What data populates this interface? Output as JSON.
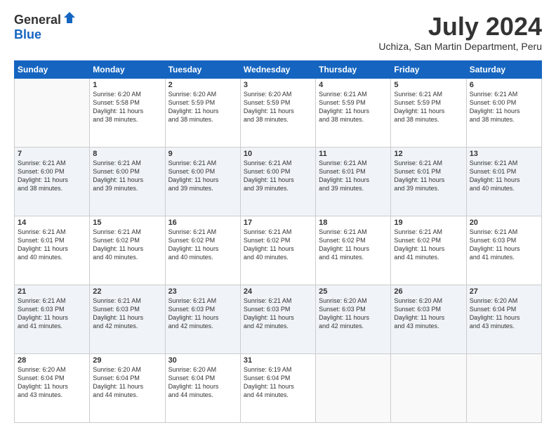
{
  "header": {
    "logo_general": "General",
    "logo_blue": "Blue",
    "month_title": "July 2024",
    "location": "Uchiza, San Martin Department, Peru"
  },
  "days_of_week": [
    "Sunday",
    "Monday",
    "Tuesday",
    "Wednesday",
    "Thursday",
    "Friday",
    "Saturday"
  ],
  "weeks": [
    [
      {
        "day": "",
        "info": ""
      },
      {
        "day": "1",
        "info": "Sunrise: 6:20 AM\nSunset: 5:58 PM\nDaylight: 11 hours\nand 38 minutes."
      },
      {
        "day": "2",
        "info": "Sunrise: 6:20 AM\nSunset: 5:59 PM\nDaylight: 11 hours\nand 38 minutes."
      },
      {
        "day": "3",
        "info": "Sunrise: 6:20 AM\nSunset: 5:59 PM\nDaylight: 11 hours\nand 38 minutes."
      },
      {
        "day": "4",
        "info": "Sunrise: 6:21 AM\nSunset: 5:59 PM\nDaylight: 11 hours\nand 38 minutes."
      },
      {
        "day": "5",
        "info": "Sunrise: 6:21 AM\nSunset: 5:59 PM\nDaylight: 11 hours\nand 38 minutes."
      },
      {
        "day": "6",
        "info": "Sunrise: 6:21 AM\nSunset: 6:00 PM\nDaylight: 11 hours\nand 38 minutes."
      }
    ],
    [
      {
        "day": "7",
        "info": "Sunrise: 6:21 AM\nSunset: 6:00 PM\nDaylight: 11 hours\nand 38 minutes."
      },
      {
        "day": "8",
        "info": "Sunrise: 6:21 AM\nSunset: 6:00 PM\nDaylight: 11 hours\nand 39 minutes."
      },
      {
        "day": "9",
        "info": "Sunrise: 6:21 AM\nSunset: 6:00 PM\nDaylight: 11 hours\nand 39 minutes."
      },
      {
        "day": "10",
        "info": "Sunrise: 6:21 AM\nSunset: 6:00 PM\nDaylight: 11 hours\nand 39 minutes."
      },
      {
        "day": "11",
        "info": "Sunrise: 6:21 AM\nSunset: 6:01 PM\nDaylight: 11 hours\nand 39 minutes."
      },
      {
        "day": "12",
        "info": "Sunrise: 6:21 AM\nSunset: 6:01 PM\nDaylight: 11 hours\nand 39 minutes."
      },
      {
        "day": "13",
        "info": "Sunrise: 6:21 AM\nSunset: 6:01 PM\nDaylight: 11 hours\nand 40 minutes."
      }
    ],
    [
      {
        "day": "14",
        "info": "Sunrise: 6:21 AM\nSunset: 6:01 PM\nDaylight: 11 hours\nand 40 minutes."
      },
      {
        "day": "15",
        "info": "Sunrise: 6:21 AM\nSunset: 6:02 PM\nDaylight: 11 hours\nand 40 minutes."
      },
      {
        "day": "16",
        "info": "Sunrise: 6:21 AM\nSunset: 6:02 PM\nDaylight: 11 hours\nand 40 minutes."
      },
      {
        "day": "17",
        "info": "Sunrise: 6:21 AM\nSunset: 6:02 PM\nDaylight: 11 hours\nand 40 minutes."
      },
      {
        "day": "18",
        "info": "Sunrise: 6:21 AM\nSunset: 6:02 PM\nDaylight: 11 hours\nand 41 minutes."
      },
      {
        "day": "19",
        "info": "Sunrise: 6:21 AM\nSunset: 6:02 PM\nDaylight: 11 hours\nand 41 minutes."
      },
      {
        "day": "20",
        "info": "Sunrise: 6:21 AM\nSunset: 6:03 PM\nDaylight: 11 hours\nand 41 minutes."
      }
    ],
    [
      {
        "day": "21",
        "info": "Sunrise: 6:21 AM\nSunset: 6:03 PM\nDaylight: 11 hours\nand 41 minutes."
      },
      {
        "day": "22",
        "info": "Sunrise: 6:21 AM\nSunset: 6:03 PM\nDaylight: 11 hours\nand 42 minutes."
      },
      {
        "day": "23",
        "info": "Sunrise: 6:21 AM\nSunset: 6:03 PM\nDaylight: 11 hours\nand 42 minutes."
      },
      {
        "day": "24",
        "info": "Sunrise: 6:21 AM\nSunset: 6:03 PM\nDaylight: 11 hours\nand 42 minutes."
      },
      {
        "day": "25",
        "info": "Sunrise: 6:20 AM\nSunset: 6:03 PM\nDaylight: 11 hours\nand 42 minutes."
      },
      {
        "day": "26",
        "info": "Sunrise: 6:20 AM\nSunset: 6:03 PM\nDaylight: 11 hours\nand 43 minutes."
      },
      {
        "day": "27",
        "info": "Sunrise: 6:20 AM\nSunset: 6:04 PM\nDaylight: 11 hours\nand 43 minutes."
      }
    ],
    [
      {
        "day": "28",
        "info": "Sunrise: 6:20 AM\nSunset: 6:04 PM\nDaylight: 11 hours\nand 43 minutes."
      },
      {
        "day": "29",
        "info": "Sunrise: 6:20 AM\nSunset: 6:04 PM\nDaylight: 11 hours\nand 44 minutes."
      },
      {
        "day": "30",
        "info": "Sunrise: 6:20 AM\nSunset: 6:04 PM\nDaylight: 11 hours\nand 44 minutes."
      },
      {
        "day": "31",
        "info": "Sunrise: 6:19 AM\nSunset: 6:04 PM\nDaylight: 11 hours\nand 44 minutes."
      },
      {
        "day": "",
        "info": ""
      },
      {
        "day": "",
        "info": ""
      },
      {
        "day": "",
        "info": ""
      }
    ]
  ]
}
